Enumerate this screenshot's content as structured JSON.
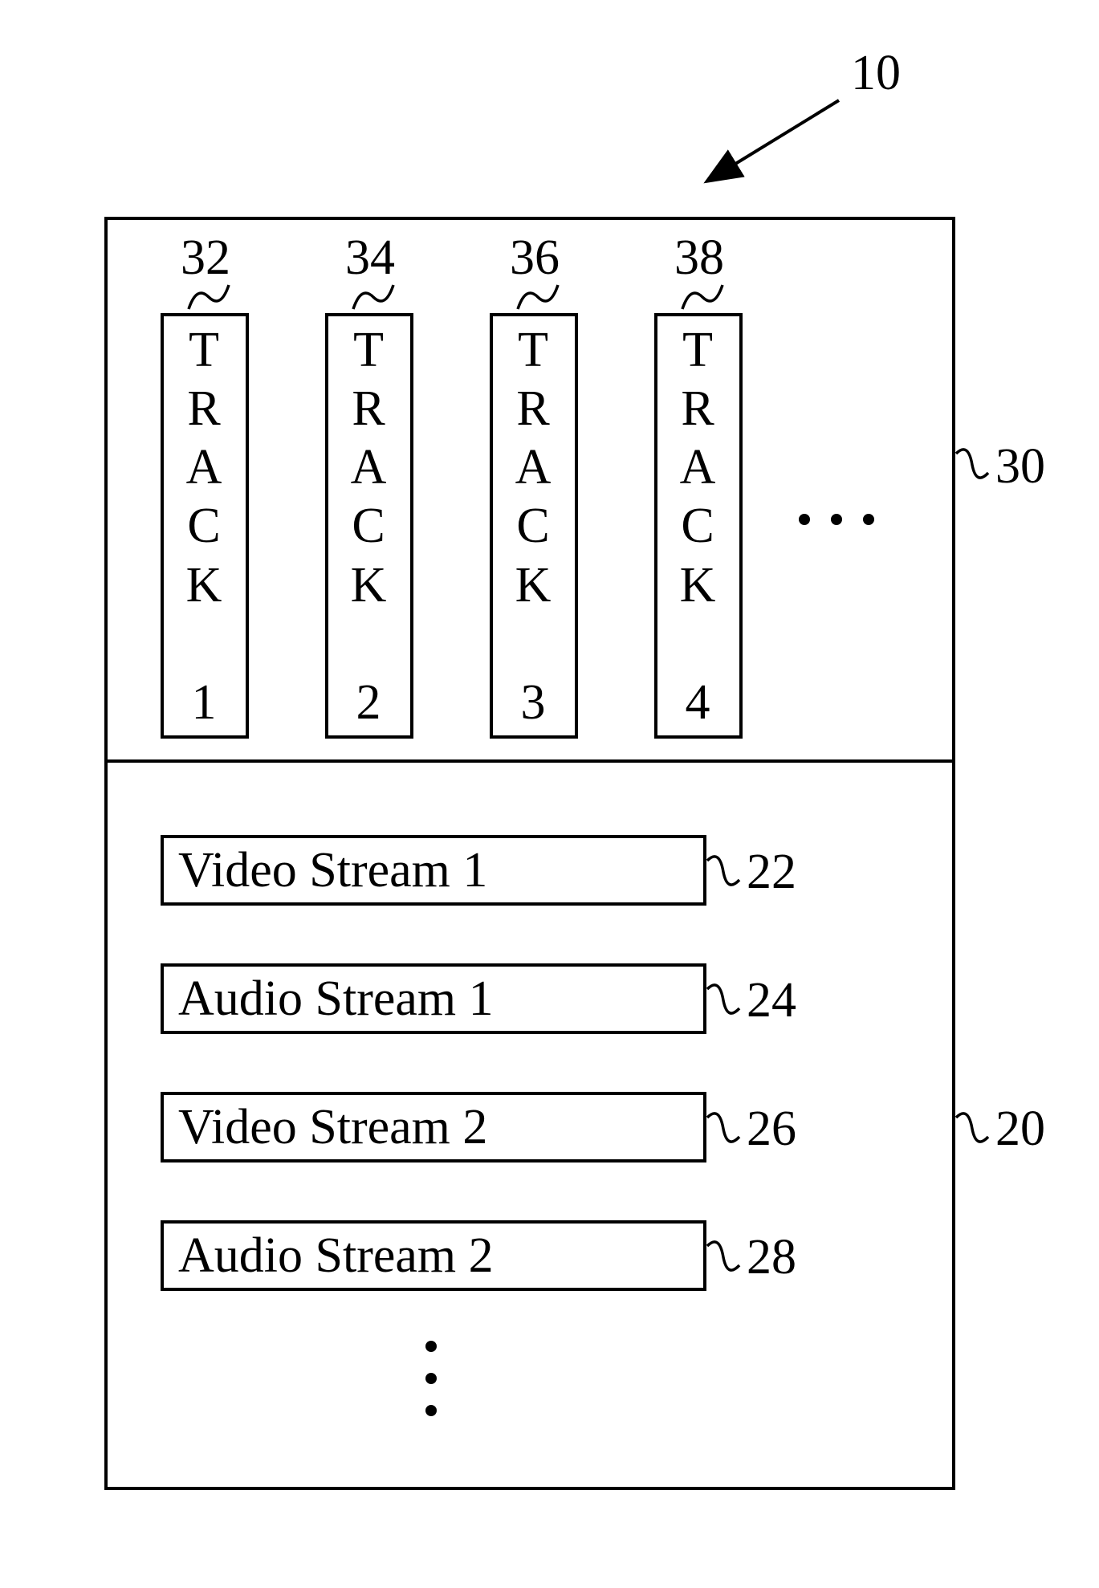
{
  "ref_main": "10",
  "top_section_ref": "30",
  "bottom_section_ref": "20",
  "tracks": [
    {
      "ref": "32",
      "label": "T\nR\nA\nC\nK\n\n1"
    },
    {
      "ref": "34",
      "label": "T\nR\nA\nC\nK\n\n2"
    },
    {
      "ref": "36",
      "label": "T\nR\nA\nC\nK\n\n3"
    },
    {
      "ref": "38",
      "label": "T\nR\nA\nC\nK\n\n4"
    }
  ],
  "streams": [
    {
      "ref": "22",
      "label": "Video Stream 1"
    },
    {
      "ref": "24",
      "label": "Audio Stream 1"
    },
    {
      "ref": "26",
      "label": "Video Stream 2"
    },
    {
      "ref": "28",
      "label": "Audio Stream 2"
    }
  ]
}
